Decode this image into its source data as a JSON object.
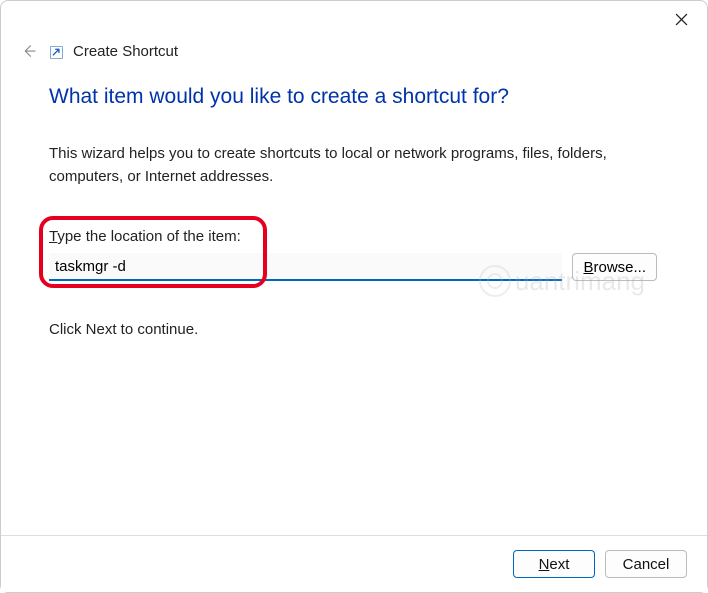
{
  "header": {
    "wizard_name": "Create Shortcut"
  },
  "main": {
    "heading": "What item would you like to create a shortcut for?",
    "description": "This wizard helps you to create shortcuts to local or network programs, files, folders, computers, or Internet addresses.",
    "input_label_pre": "T",
    "input_label_rest": "ype the location of the item:",
    "input_value": "taskmgr -d",
    "browse_pre": "B",
    "browse_rest": "rowse...",
    "continue_text": "Click Next to continue."
  },
  "footer": {
    "next_pre": "N",
    "next_rest": "ext",
    "cancel": "Cancel"
  },
  "watermark": {
    "text": "uantrimang"
  }
}
